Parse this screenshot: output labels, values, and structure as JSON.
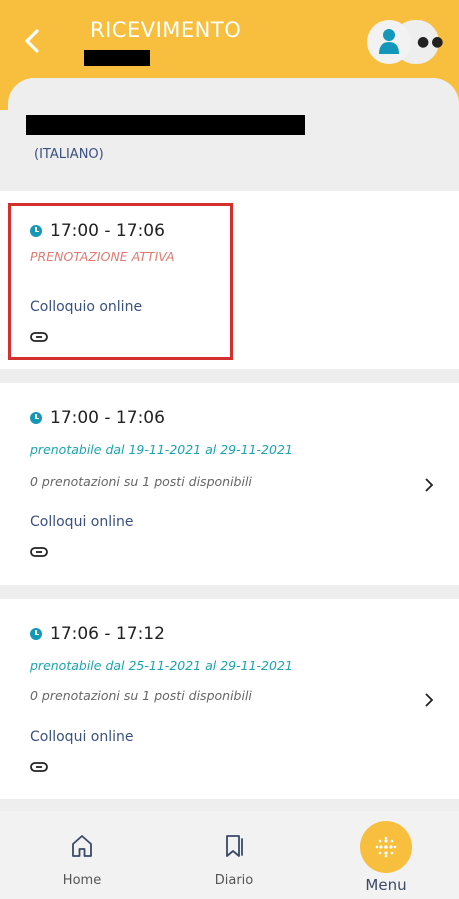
{
  "header": {
    "title": "RICEVIMENTO",
    "accent_color": "#f8bf3f"
  },
  "teacher": {
    "subject": "(ITALIANO)"
  },
  "slots": [
    {
      "time": "17:00 - 17:06",
      "status": "PRENOTAZIONE ATTIVA",
      "mode": "Colloquio online"
    },
    {
      "time": "17:00 - 17:06",
      "availability": "prenotabile dal 19-11-2021 al 29-11-2021",
      "bookings": "0 prenotazioni su 1 posti disponibili",
      "mode": "Colloqui online"
    },
    {
      "time": "17:06 - 17:12",
      "availability": "prenotabile dal 25-11-2021 al 29-11-2021",
      "bookings": "0 prenotazioni su 1 posti disponibili",
      "mode": "Colloqui online"
    }
  ],
  "nav": {
    "home": "Home",
    "diario": "Diario",
    "menu": "Menu"
  },
  "colors": {
    "clock": "#1497b8",
    "active_status": "#e07b73",
    "availability": "#1aa4b0",
    "highlight": "#d32f2f"
  }
}
